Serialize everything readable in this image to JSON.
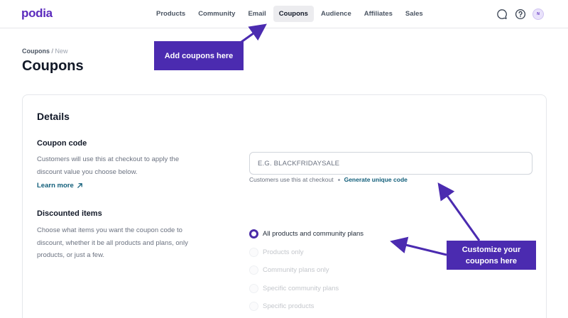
{
  "app": {
    "logo": "podia"
  },
  "nav": {
    "items": [
      {
        "label": "Products",
        "active": false
      },
      {
        "label": "Community",
        "active": false
      },
      {
        "label": "Email",
        "active": false
      },
      {
        "label": "Coupons",
        "active": true
      },
      {
        "label": "Audience",
        "active": false
      },
      {
        "label": "Affiliates",
        "active": false
      },
      {
        "label": "Sales",
        "active": false
      }
    ],
    "icons": [
      "chat-bubble-icon",
      "help-icon"
    ],
    "avatar_initial": "N"
  },
  "breadcrumb": {
    "parent": "Coupons",
    "separator": "/",
    "current": "New"
  },
  "page_title": "Coupons",
  "details": {
    "title": "Details",
    "coupon_code": {
      "title": "Coupon code",
      "description": "Customers will use this at checkout to apply the discount value you choose below.",
      "learn_more": "Learn more",
      "input_value": "",
      "input_placeholder": "E.G. BLACKFRIDAYSALE",
      "helper_text": "Customers use this at checkout",
      "generate_link": "Generate unique code"
    },
    "discounted_items": {
      "title": "Discounted items",
      "description": "Choose what items you want the coupon code to discount, whether it be all products and plans, only products, or just a few.",
      "options": [
        {
          "label": "All products and community plans",
          "selected": true
        },
        {
          "label": "Products only",
          "selected": false
        },
        {
          "label": "Community plans only",
          "selected": false
        },
        {
          "label": "Specific community plans",
          "selected": false
        },
        {
          "label": "Specific products",
          "selected": false
        }
      ]
    }
  },
  "annotations": {
    "add_coupons": "Add coupons here",
    "customize_line1": "Customize your",
    "customize_line2": "coupons here"
  },
  "colors": {
    "brand": "#5b2bbd",
    "annotation": "#4b2bb0",
    "link": "#115e7a",
    "radio_checked": "#4a2ba8"
  }
}
